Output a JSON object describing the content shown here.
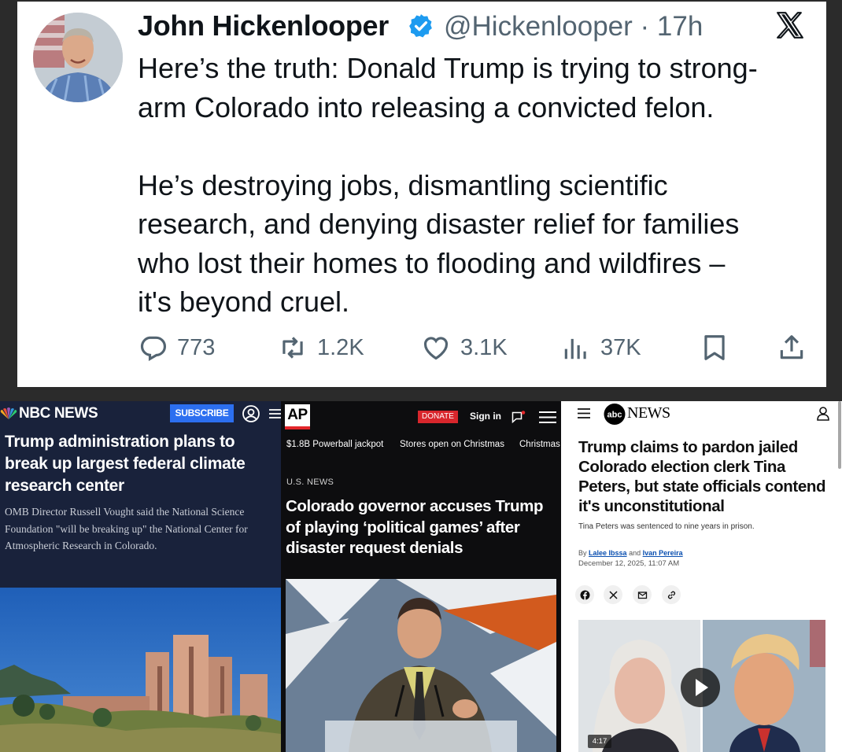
{
  "tweet": {
    "name": "John Hickenlooper",
    "handle_time": "@Hickenlooper · 17h",
    "paragraphs": [
      "Here’s the truth: Donald Trump is trying to strong-\narm Colorado into releasing a convicted felon.",
      "He’s destroying jobs, dismantling scientific\nresearch, and denying disaster relief for families\nwho lost their homes to flooding and wildfires –\nit's beyond cruel."
    ],
    "replies": "773",
    "reposts": "1.2K",
    "likes": "3.1K",
    "views": "37K",
    "icons": [
      "verified-badge-icon",
      "x-logo-icon",
      "reply-icon",
      "repost-icon",
      "like-icon",
      "views-icon",
      "bookmark-icon",
      "share-icon"
    ],
    "colors": {
      "text": "#0f1419",
      "muted": "#536471",
      "verified": "#1d9bf0"
    }
  },
  "nbc": {
    "brand": "NBC NEWS",
    "subscribe": "SUBSCRIBE",
    "headline": "Trump administration plans to break up largest federal climate research center",
    "dek": "OMB Director Russell Vought said the National Science Foundation \"will be breaking up\" the National Center for Atmospheric Research in Colorado.",
    "colors": {
      "background": "#19223b",
      "subscribe": "#2c6ff0"
    }
  },
  "ap": {
    "logo": "AP",
    "donate": "DONATE",
    "sign_in": "Sign in",
    "trending": [
      "$1.8B Powerball jackpot",
      "Stores open on Christmas",
      "Christmas"
    ],
    "kicker": "U.S. NEWS",
    "headline": "Colorado governor accuses Trump of playing ‘political games’ after disaster request denials",
    "colors": {
      "background": "#0d0d0f",
      "donate": "#d8262c"
    }
  },
  "abc": {
    "brand": "NEWS",
    "headline": "Trump claims to pardon jailed Colorado election clerk Tina Peters, but state officials contend it's unconstitutional",
    "dek": "Tina Peters was sentenced to nine years in prison.",
    "by": "By",
    "author1": "Lalee Ibssa",
    "and": "and",
    "author2": "Ivan Pereira",
    "date": "December 12, 2025, 11:07 AM",
    "video_duration": "4:17",
    "share_icons": [
      "facebook-icon",
      "x-icon",
      "email-icon",
      "link-icon"
    ]
  }
}
